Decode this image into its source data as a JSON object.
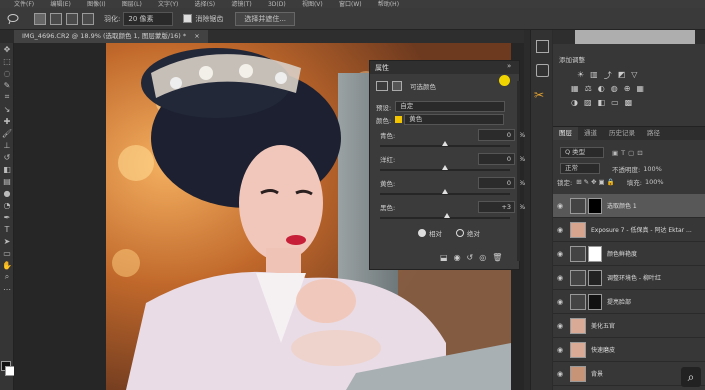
{
  "menu": {
    "items": [
      "文件(F)",
      "编辑(E)",
      "图像(I)",
      "图层(L)",
      "文字(Y)",
      "选择(S)",
      "滤镜(T)",
      "3D(D)",
      "视图(V)",
      "窗口(W)",
      "帮助(H)"
    ]
  },
  "options": {
    "feather_label": "羽化:",
    "feather_value": "20 像素",
    "antialias_label": "消除锯齿",
    "select_mask_btn": "选择并遮住..."
  },
  "document": {
    "tab_title": "IMG_4696.CR2 @ 18.9% (选取颜色 1, 图层蒙版/16) *"
  },
  "properties": {
    "title": "属性",
    "type_label": "可选颜色",
    "preset_label": "预设:",
    "preset_value": "自定",
    "color_label": "颜色:",
    "color_value": "黄色",
    "color_swatch": "#f2c500",
    "sliders": [
      {
        "label": "青色:",
        "value": "0",
        "unit": "%",
        "level": 0
      },
      {
        "label": "洋红:",
        "value": "0",
        "unit": "%",
        "level": 0
      },
      {
        "label": "黄色:",
        "value": "0",
        "unit": "%",
        "level": 0
      },
      {
        "label": "黑色:",
        "value": "+3",
        "unit": "%",
        "level": 3
      }
    ],
    "method_relative": "相对",
    "method_absolute": "绝对",
    "selected_method": "relative"
  },
  "adjust_panel": {
    "title": "添加调整"
  },
  "layers_panel": {
    "tabs": [
      "图层",
      "通道",
      "历史记录",
      "路径"
    ],
    "kind_label": "Q 类型",
    "blend_mode": "正常",
    "opacity_label": "不透明度:",
    "opacity_value": "100%",
    "lock_label": "锁定:",
    "fill_label": "填充:",
    "fill_value": "100%",
    "layers": [
      {
        "name": "选取颜色 1",
        "selected": true
      },
      {
        "name": "Exposure 7 - 低保真 - 阿达 Ektar ..."
      },
      {
        "name": "颜色鲜艳度"
      },
      {
        "name": "调整环境色 - 柳叶红"
      },
      {
        "name": "提亮脸部"
      },
      {
        "name": "美化五官"
      },
      {
        "name": "快速磨皮"
      },
      {
        "name": "背景"
      }
    ]
  }
}
